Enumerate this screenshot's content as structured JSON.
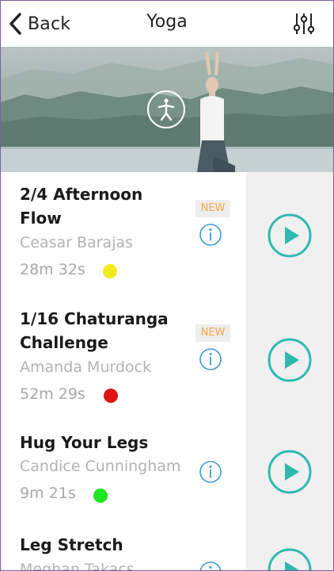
{
  "nav": {
    "back_label": "Back",
    "title": "Yoga",
    "back_icon": "chevron-left-icon",
    "filter_icon": "sliders-icon"
  },
  "hero": {
    "badge_icon": "yoga-pose-icon"
  },
  "colors": {
    "accent": "#2fb8b0",
    "info": "#3a9bd9",
    "new_badge": "#f5a54b"
  },
  "items": [
    {
      "title_lines": [
        "2/4 Afternoon",
        "Flow"
      ],
      "author": "Ceasar Barajas",
      "duration": "28m 32s",
      "level_color": "#f3ea1e",
      "badge": "NEW"
    },
    {
      "title_lines": [
        "1/16 Chaturanga",
        "Challenge"
      ],
      "author": "Amanda Murdock",
      "duration": "52m 29s",
      "level_color": "#e01414",
      "badge": "NEW"
    },
    {
      "title_lines": [
        "Hug Your Legs"
      ],
      "author": "Candice Cunningham",
      "duration": "9m 21s",
      "level_color": "#1ee61e",
      "badge": ""
    },
    {
      "title_lines": [
        "Leg Stretch"
      ],
      "author": "Meghan Takacs",
      "duration": "",
      "level_color": "",
      "badge": ""
    }
  ]
}
